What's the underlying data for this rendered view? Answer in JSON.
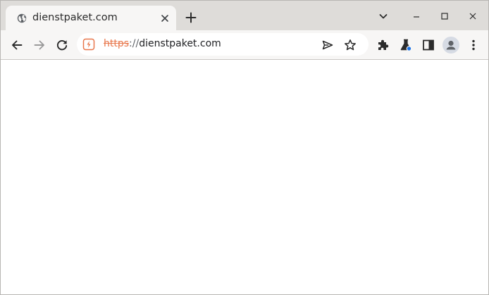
{
  "tab": {
    "title": "dienstpaket.com",
    "favicon_icon": "globe-icon",
    "close_icon": "close-icon"
  },
  "tabstrip": {
    "new_tab_icon": "plus-icon"
  },
  "window_controls": {
    "tab_search_icon": "chevron-down-icon",
    "minimize_icon": "minimize-icon",
    "maximize_icon": "maximize-icon",
    "close_icon": "close-icon"
  },
  "toolbar": {
    "back_icon": "arrow-left-icon",
    "forward_icon": "arrow-right-icon",
    "reload_icon": "reload-icon",
    "extensions_icon": "puzzle-icon",
    "labs_icon": "flask-icon",
    "side_panel_icon": "side-panel-icon",
    "menu_icon": "kebab-menu-icon"
  },
  "omnibox": {
    "security_icon": "not-secure-warning-icon",
    "url_scheme": "https",
    "url_separator": "://",
    "url_host": "dienstpaket.com",
    "send_icon": "send-icon",
    "bookmark_icon": "star-icon"
  },
  "colors": {
    "tabstrip_bg": "#dedcd9",
    "toolbar_bg": "#f7f6f5",
    "url_scheme_warning": "#e8764a",
    "labs_badge": "#1a73e8",
    "content_bg": "#ffffff"
  }
}
